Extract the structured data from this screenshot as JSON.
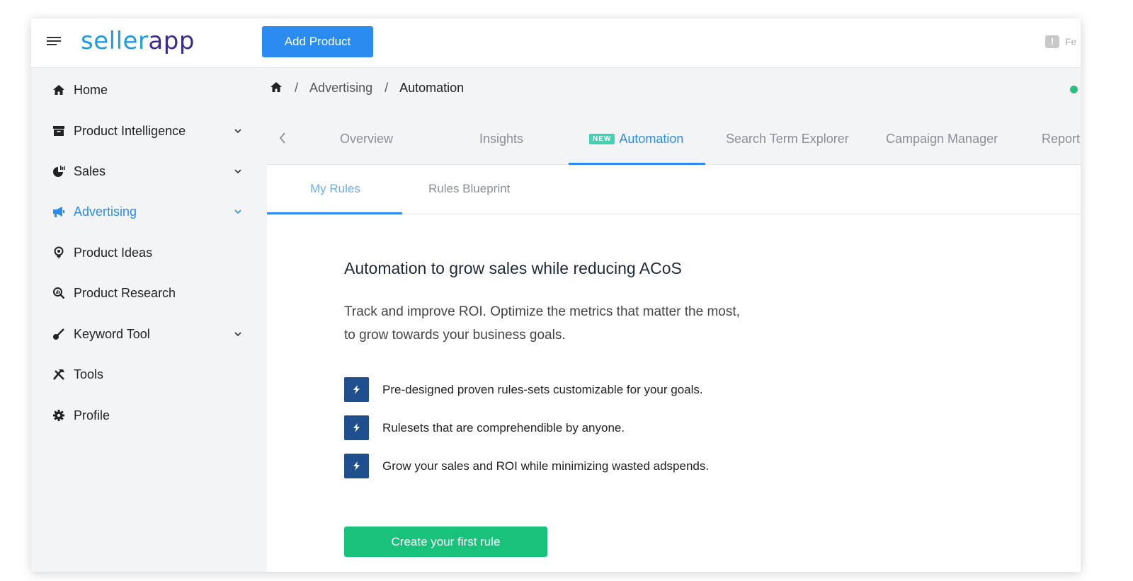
{
  "app": {
    "logo_part1": "seller",
    "logo_part2": "app",
    "add_product_label": "Add Product",
    "feedback_label": "Fe"
  },
  "colors": {
    "primary": "#2a8cf0",
    "cta_green": "#19c27a",
    "new_badge": "#3fd3b2",
    "feature_box": "#1f4f8c",
    "status": "#27c080"
  },
  "sidebar": {
    "items": [
      {
        "label": "Home",
        "icon": "home-icon",
        "has_submenu": false,
        "active": false
      },
      {
        "label": "Product Intelligence",
        "icon": "archive-icon",
        "has_submenu": true,
        "active": false
      },
      {
        "label": "Sales",
        "icon": "pie-chart-icon",
        "has_submenu": true,
        "active": false
      },
      {
        "label": "Advertising",
        "icon": "megaphone-icon",
        "has_submenu": true,
        "active": true
      },
      {
        "label": "Product Ideas",
        "icon": "lightbulb-icon",
        "has_submenu": false,
        "active": false
      },
      {
        "label": "Product Research",
        "icon": "search-chart-icon",
        "has_submenu": false,
        "active": false
      },
      {
        "label": "Keyword Tool",
        "icon": "key-icon",
        "has_submenu": true,
        "active": false
      },
      {
        "label": "Tools",
        "icon": "tools-icon",
        "has_submenu": false,
        "active": false
      },
      {
        "label": "Profile",
        "icon": "gear-icon",
        "has_submenu": false,
        "active": false
      }
    ]
  },
  "breadcrumb": {
    "sep": "/",
    "items": [
      "Advertising",
      "Automation"
    ]
  },
  "tabs": {
    "new_badge": "NEW",
    "items": [
      "Overview",
      "Insights",
      "Automation",
      "Search Term Explorer",
      "Campaign Manager",
      "Report"
    ],
    "active": "Automation"
  },
  "subtabs": {
    "items": [
      "My Rules",
      "Rules Blueprint"
    ],
    "active": "My Rules"
  },
  "main": {
    "headline": "Automation to grow sales while reducing ACoS",
    "description": "Track and improve ROI. Optimize the metrics that matter the most, to grow towards your business goals.",
    "features": [
      "Pre-designed proven rules-sets customizable for your goals.",
      "Rulesets that are comprehendible by anyone.",
      "Grow your sales and ROI while minimizing wasted adspends."
    ],
    "cta_label": "Create your first rule"
  }
}
